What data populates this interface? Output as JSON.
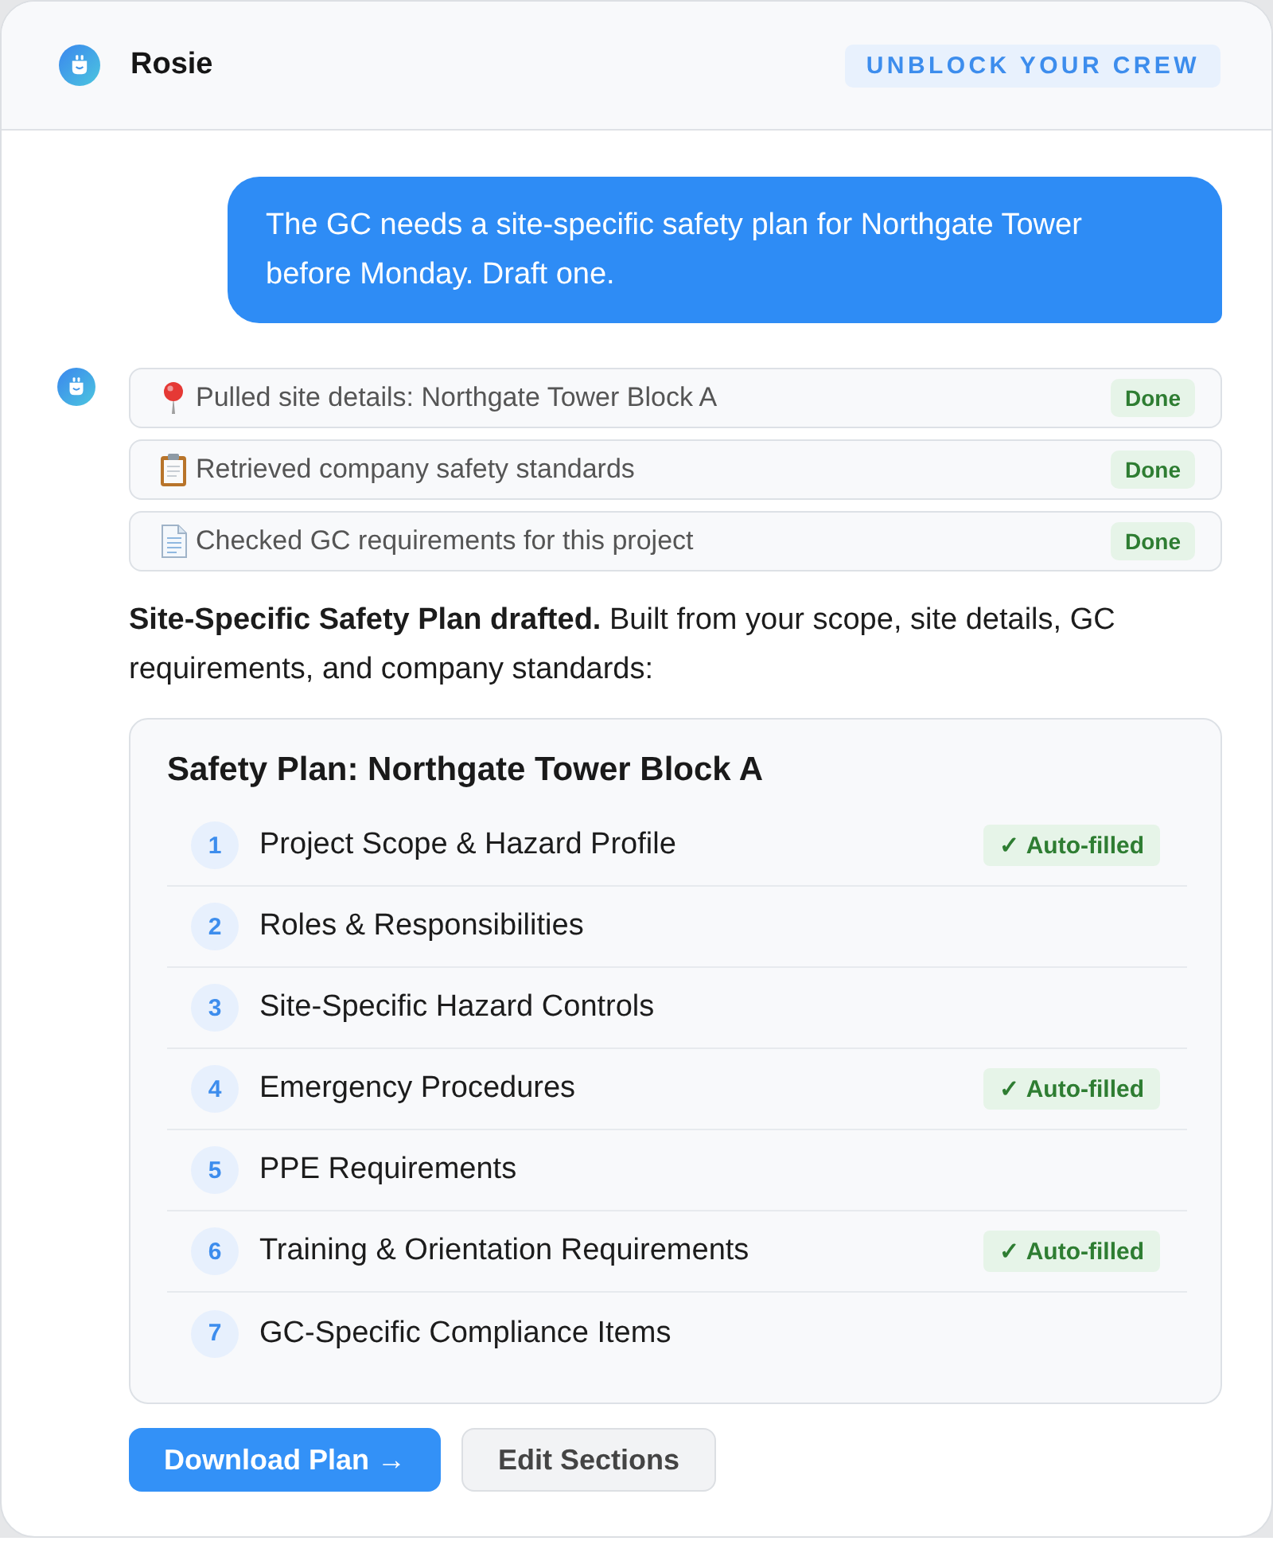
{
  "header": {
    "title": "Rosie",
    "tagline": "UNBLOCK YOUR CREW"
  },
  "messages": [
    {
      "kind": "user",
      "text": "The GC needs a site-specific safety plan for Northgate Tower before Monday. Draft one."
    },
    {
      "kind": "assistant",
      "steps": [
        {
          "kind": "location",
          "text": "Pulled site details: Northgate Tower Block A",
          "status": "Done"
        },
        {
          "kind": "clipboard",
          "text": "Retrieved company safety standards",
          "status": "Done"
        },
        {
          "kind": "document",
          "text": "Checked GC requirements for this project",
          "status": "Done"
        }
      ],
      "summary": "**Site-Specific Safety Plan drafted.** Built from your scope, site details, GC requirements, and company standards:",
      "plan": {
        "title": "Safety Plan: Northgate Tower Block A",
        "sections": [
          {
            "number": "1",
            "title": "Project Scope & Hazard Profile",
            "badge": "✓ Auto-filled"
          },
          {
            "number": "2",
            "title": "Roles & Responsibilities"
          },
          {
            "number": "3",
            "title": "Site-Specific Hazard Controls"
          },
          {
            "number": "4",
            "title": "Emergency Procedures",
            "badge": "✓ Auto-filled"
          },
          {
            "number": "5",
            "title": "PPE Requirements"
          },
          {
            "number": "6",
            "title": "Training & Orientation Requirements",
            "badge": "✓ Auto-filled"
          },
          {
            "number": "7",
            "title": "GC-Specific Compliance Items"
          }
        ]
      },
      "actions": [
        {
          "kind": "primary",
          "label": "Download Plan →"
        },
        {
          "kind": "secondary",
          "label": "Edit Sections"
        }
      ]
    }
  ]
}
